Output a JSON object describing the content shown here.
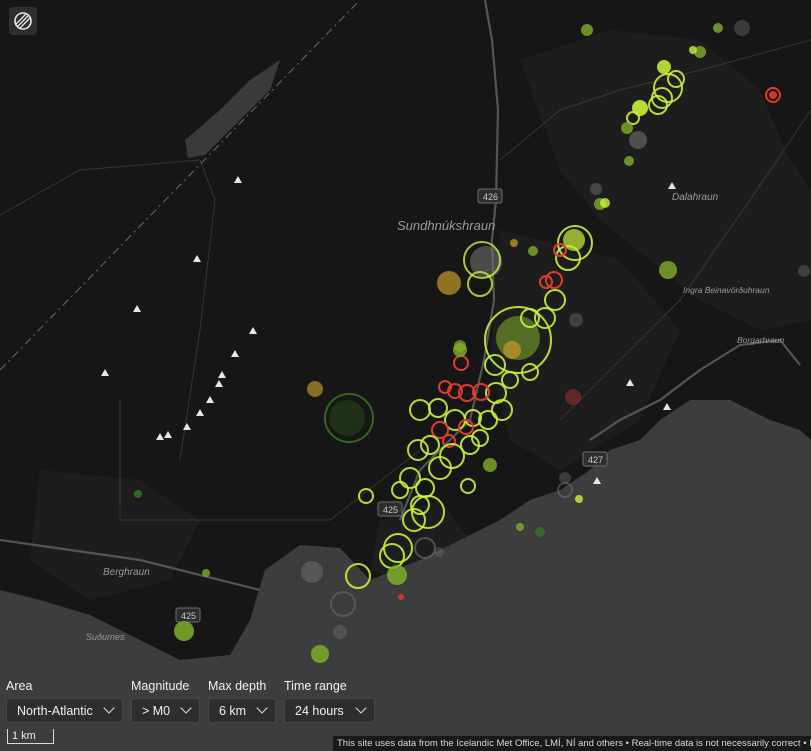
{
  "map": {
    "place_labels": [
      {
        "name": "Sundhnúkshraun"
      },
      {
        "name": "Dalahraun"
      },
      {
        "name": "Ingra Beinavörðuhraun"
      },
      {
        "name": "Borgarhraun"
      },
      {
        "name": "Berghraun"
      },
      {
        "name": "Suðurnes"
      }
    ],
    "road_numbers": [
      "426",
      "427",
      "425",
      "425"
    ],
    "colors": {
      "land": "#161616",
      "sea": "#3d3d3d",
      "quake_recent": "#c9f23a",
      "quake_older": "#7fae2c",
      "quake_old": "#3a7a1f",
      "quake_red": "#e23b2c",
      "quake_yellow": "#b8922a",
      "quake_grey": "#707070"
    }
  },
  "logo": {
    "icon": "vedur-logo-icon"
  },
  "filters": [
    {
      "label": "Area",
      "value": "North-Atlantic"
    },
    {
      "label": "Magnitude",
      "value": "> M0"
    },
    {
      "label": "Max depth",
      "value": "6 km"
    },
    {
      "label": "Time range",
      "value": "24 hours"
    }
  ],
  "scale": {
    "label": "1 km"
  },
  "attribution": "This site uses data from the Icelandic Met Office, LMÍ, NÍ and others • Real-time data is not necessarily correct • I"
}
